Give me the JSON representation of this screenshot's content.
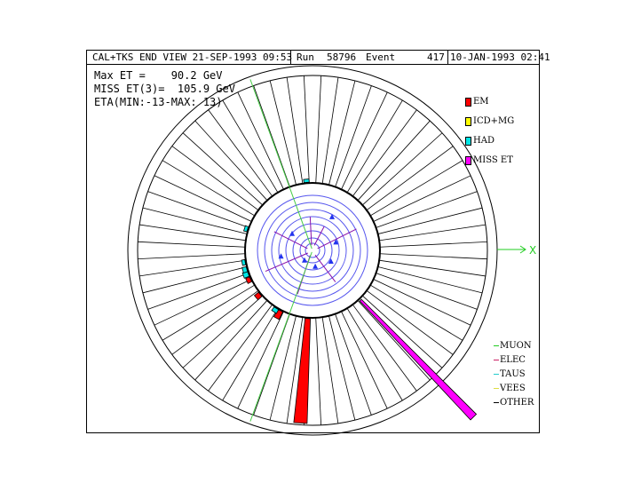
{
  "header": {
    "view_title": "CAL+TKS END VIEW 21-SEP-1993 09:53",
    "run_label": "Run",
    "run_number": "58796",
    "event_label": "Event",
    "event_number": "417",
    "event_datetime": "10-JAN-1993 02:41"
  },
  "info": {
    "max_et": "Max ET =    90.2 GeV",
    "miss_et": "MISS ET(3)=  105.9 GeV",
    "eta_range": "ETA(MIN:-13-MAX: 13)"
  },
  "axis": {
    "x_label": "X"
  },
  "legend": [
    {
      "label": "EM",
      "color": "#ff0000"
    },
    {
      "label": "ICD+MG",
      "color": "#ffff00"
    },
    {
      "label": "HAD",
      "color": "#00e6e6"
    },
    {
      "label": "MISS ET",
      "color": "#ff00ff"
    }
  ],
  "track_legend": [
    {
      "label": "MUON",
      "color": "#22cc22"
    },
    {
      "label": "ELEC",
      "color": "#cc2266"
    },
    {
      "label": "TAUS",
      "color": "#22cccc"
    },
    {
      "label": "VEES",
      "color": "#dddd44"
    },
    {
      "label": "OTHER",
      "color": "#000000"
    }
  ],
  "display": {
    "calorimeter_segments": 64,
    "towers": [
      {
        "detector": "EM",
        "angle_deg": 266,
        "et_fraction": 1.0
      },
      {
        "detector": "EM",
        "angle_deg": 242,
        "et_fraction": 0.08
      },
      {
        "detector": "EM",
        "angle_deg": 220,
        "et_fraction": 0.05
      },
      {
        "detector": "EM",
        "angle_deg": 205,
        "et_fraction": 0.04
      },
      {
        "detector": "HAD",
        "angle_deg": 238,
        "et_fraction": 0.04
      },
      {
        "detector": "HAD",
        "angle_deg": 200,
        "et_fraction": 0.05
      },
      {
        "detector": "HAD",
        "angle_deg": 196,
        "et_fraction": 0.04
      },
      {
        "detector": "HAD",
        "angle_deg": 190,
        "et_fraction": 0.03
      },
      {
        "detector": "HAD",
        "angle_deg": 162,
        "et_fraction": 0.03
      },
      {
        "detector": "HAD",
        "angle_deg": 95,
        "et_fraction": 0.03
      }
    ],
    "missing_et_angle_deg": 314
  }
}
